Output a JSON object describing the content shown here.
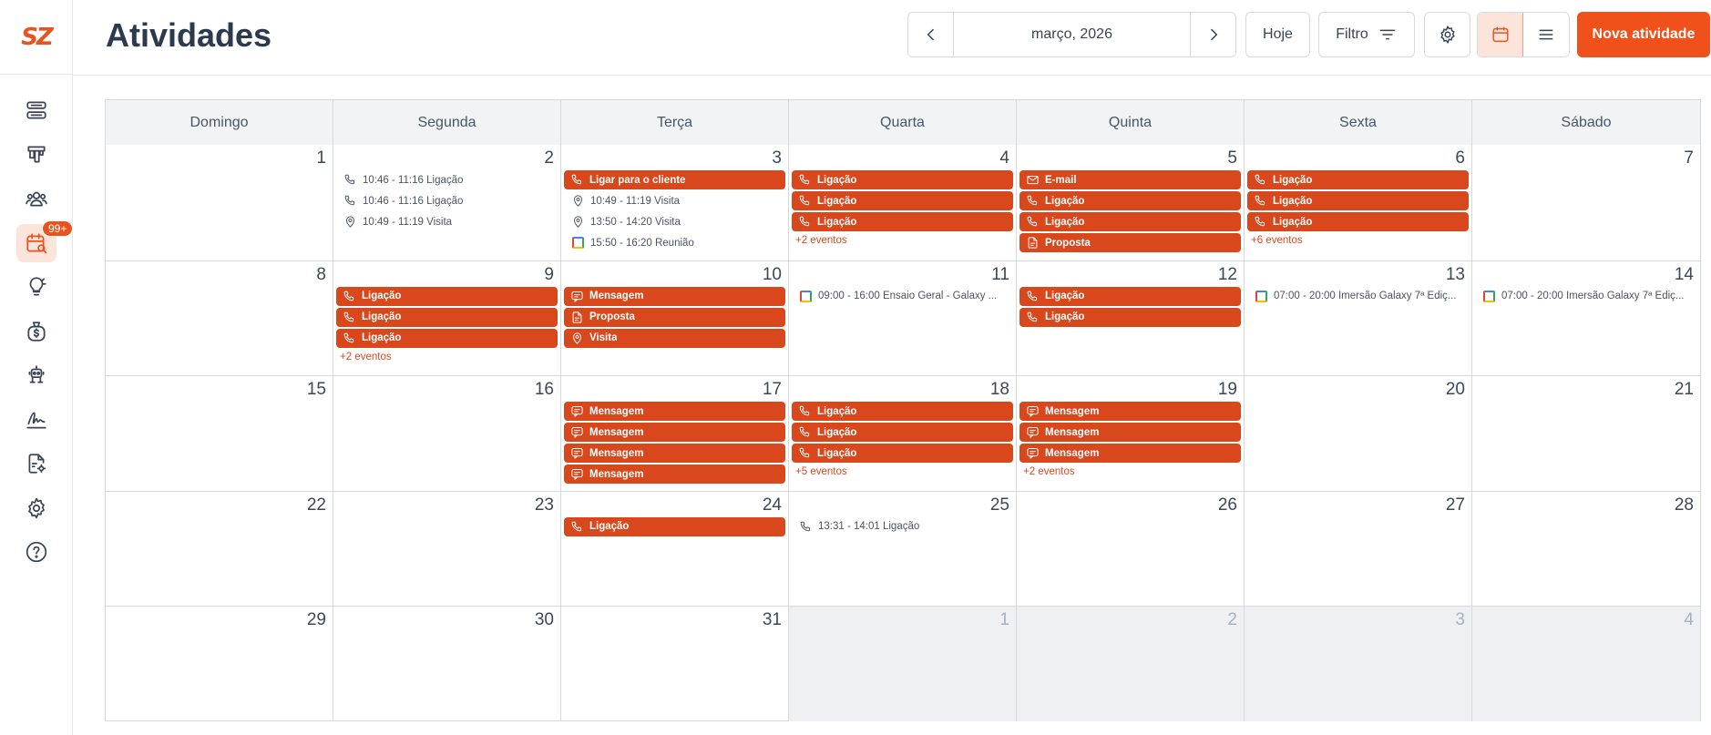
{
  "app": {
    "logo_text": "SZ",
    "title": "Atividades"
  },
  "colors": {
    "accent": "#f0511b",
    "event_fill": "#d9481c",
    "active_nav_bg": "#fde4da"
  },
  "sidebar": {
    "items": [
      {
        "name": "servers-icon"
      },
      {
        "name": "pipeline-icon"
      },
      {
        "name": "contacts-icon"
      },
      {
        "name": "activities-icon",
        "active": true,
        "badge": "99+"
      },
      {
        "name": "ideas-icon"
      },
      {
        "name": "money-bag-icon"
      },
      {
        "name": "robot-icon"
      },
      {
        "name": "signature-icon"
      },
      {
        "name": "document-settings-icon"
      },
      {
        "name": "settings-icon"
      },
      {
        "name": "help-icon"
      }
    ]
  },
  "toolbar": {
    "month_label": "março, 2026",
    "today_label": "Hoje",
    "filter_label": "Filtro",
    "new_label": "Nova atividade"
  },
  "calendar": {
    "weekdays": [
      "Domingo",
      "Segunda",
      "Terça",
      "Quarta",
      "Quinta",
      "Sexta",
      "Sábado"
    ],
    "weeks": [
      [
        {
          "num": "1",
          "events": []
        },
        {
          "num": "2",
          "events": [
            {
              "style": "plain",
              "icon": "phone",
              "text": "10:46 - 11:16 Ligação"
            },
            {
              "style": "plain",
              "icon": "phone",
              "text": "10:46 - 11:16 Ligação"
            },
            {
              "style": "plain",
              "icon": "pin",
              "text": "10:49 - 11:19 Visita"
            }
          ]
        },
        {
          "num": "3",
          "events": [
            {
              "style": "filled",
              "icon": "phone",
              "text": "Ligar para o cliente"
            },
            {
              "style": "plain",
              "icon": "pin",
              "text": "10:49 - 11:19 Visita"
            },
            {
              "style": "plain",
              "icon": "pin",
              "text": "13:50 - 14:20 Visita"
            },
            {
              "style": "plain",
              "icon": "gcal",
              "text": "15:50 - 16:20 Reunião"
            }
          ]
        },
        {
          "num": "4",
          "events": [
            {
              "style": "filled",
              "icon": "phone",
              "text": "Ligação"
            },
            {
              "style": "filled",
              "icon": "phone",
              "text": "Ligação"
            },
            {
              "style": "filled",
              "icon": "phone",
              "text": "Ligação"
            }
          ],
          "more": "+2 eventos"
        },
        {
          "num": "5",
          "events": [
            {
              "style": "filled",
              "icon": "mail",
              "text": "E-mail"
            },
            {
              "style": "filled",
              "icon": "phone",
              "text": "Ligação"
            },
            {
              "style": "filled",
              "icon": "phone",
              "text": "Ligação"
            },
            {
              "style": "filled",
              "icon": "doc",
              "text": "Proposta"
            }
          ]
        },
        {
          "num": "6",
          "events": [
            {
              "style": "filled",
              "icon": "phone",
              "text": "Ligação"
            },
            {
              "style": "filled",
              "icon": "phone",
              "text": "Ligação"
            },
            {
              "style": "filled",
              "icon": "phone",
              "text": "Ligação"
            }
          ],
          "more": "+6 eventos"
        },
        {
          "num": "7",
          "events": []
        }
      ],
      [
        {
          "num": "8",
          "events": []
        },
        {
          "num": "9",
          "events": [
            {
              "style": "filled",
              "icon": "phone",
              "text": "Ligação"
            },
            {
              "style": "filled",
              "icon": "phone",
              "text": "Ligação"
            },
            {
              "style": "filled",
              "icon": "phone",
              "text": "Ligação"
            }
          ],
          "more": "+2 eventos"
        },
        {
          "num": "10",
          "events": [
            {
              "style": "filled",
              "icon": "message",
              "text": "Mensagem"
            },
            {
              "style": "filled",
              "icon": "doc",
              "text": "Proposta"
            },
            {
              "style": "filled",
              "icon": "pin",
              "text": "Visita"
            }
          ]
        },
        {
          "num": "11",
          "events": [
            {
              "style": "plain",
              "icon": "gcal",
              "text": "09:00 - 16:00 Ensaio Geral - Galaxy ..."
            }
          ]
        },
        {
          "num": "12",
          "events": [
            {
              "style": "filled",
              "icon": "phone",
              "text": "Ligação"
            },
            {
              "style": "filled",
              "icon": "phone",
              "text": "Ligação"
            }
          ]
        },
        {
          "num": "13",
          "events": [
            {
              "style": "plain",
              "icon": "gcal",
              "text": "07:00 - 20:00 Imersão Galaxy 7ª Ediç..."
            }
          ]
        },
        {
          "num": "14",
          "events": [
            {
              "style": "plain",
              "icon": "gcal",
              "text": "07:00 - 20:00 Imersão Galaxy 7ª Ediç..."
            }
          ]
        }
      ],
      [
        {
          "num": "15",
          "events": []
        },
        {
          "num": "16",
          "events": []
        },
        {
          "num": "17",
          "events": [
            {
              "style": "filled",
              "icon": "message",
              "text": "Mensagem"
            },
            {
              "style": "filled",
              "icon": "message",
              "text": "Mensagem"
            },
            {
              "style": "filled",
              "icon": "message",
              "text": "Mensagem"
            },
            {
              "style": "filled",
              "icon": "message",
              "text": "Mensagem"
            }
          ]
        },
        {
          "num": "18",
          "events": [
            {
              "style": "filled",
              "icon": "phone",
              "text": "Ligação"
            },
            {
              "style": "filled",
              "icon": "phone",
              "text": "Ligação"
            },
            {
              "style": "filled",
              "icon": "phone",
              "text": "Ligação"
            }
          ],
          "more": "+5 eventos"
        },
        {
          "num": "19",
          "events": [
            {
              "style": "filled",
              "icon": "message",
              "text": "Mensagem"
            },
            {
              "style": "filled",
              "icon": "message",
              "text": "Mensagem"
            },
            {
              "style": "filled",
              "icon": "message",
              "text": "Mensagem"
            }
          ],
          "more": "+2 eventos"
        },
        {
          "num": "20",
          "events": []
        },
        {
          "num": "21",
          "events": []
        }
      ],
      [
        {
          "num": "22",
          "events": []
        },
        {
          "num": "23",
          "events": []
        },
        {
          "num": "24",
          "events": [
            {
              "style": "filled",
              "icon": "phone",
              "text": "Ligação"
            }
          ]
        },
        {
          "num": "25",
          "events": [
            {
              "style": "plain",
              "icon": "phone",
              "text": "13:31 - 14:01 Ligação"
            }
          ]
        },
        {
          "num": "26",
          "events": []
        },
        {
          "num": "27",
          "events": []
        },
        {
          "num": "28",
          "events": []
        }
      ],
      [
        {
          "num": "29",
          "events": []
        },
        {
          "num": "30",
          "events": []
        },
        {
          "num": "31",
          "events": []
        },
        {
          "num": "1",
          "other": true,
          "events": []
        },
        {
          "num": "2",
          "other": true,
          "events": []
        },
        {
          "num": "3",
          "other": true,
          "events": []
        },
        {
          "num": "4",
          "other": true,
          "events": []
        }
      ]
    ]
  }
}
